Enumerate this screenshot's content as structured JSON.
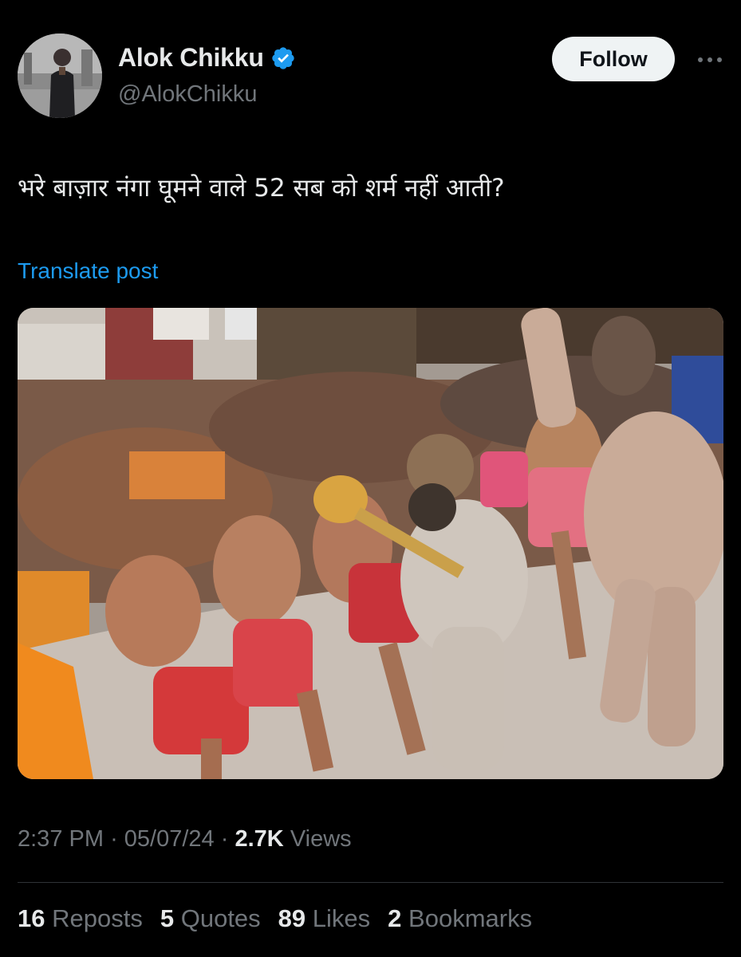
{
  "author": {
    "display_name": "Alok Chikku",
    "handle": "@AlokChikku",
    "verified": true,
    "verified_color": "#1d9bf0"
  },
  "follow_label": "Follow",
  "more_icon": "ellipsis-icon",
  "post": {
    "text": "भरे बाज़ार नंगा घूमने वाले 52 सब को शर्म नहीं आती?",
    "translate_label": "Translate post"
  },
  "meta": {
    "time": "2:37 PM",
    "separator": "·",
    "date": "05/07/24",
    "views_count": "2.7K",
    "views_label": "Views"
  },
  "stats": [
    {
      "count": "16",
      "label": "Reposts"
    },
    {
      "count": "5",
      "label": "Quotes"
    },
    {
      "count": "89",
      "label": "Likes"
    },
    {
      "count": "2",
      "label": "Bookmarks"
    }
  ],
  "colors": {
    "background": "#000000",
    "text_primary": "#e7e9ea",
    "text_secondary": "#71767b",
    "link": "#1d9bf0",
    "divider": "#2f3336",
    "follow_bg": "#eff3f4"
  }
}
